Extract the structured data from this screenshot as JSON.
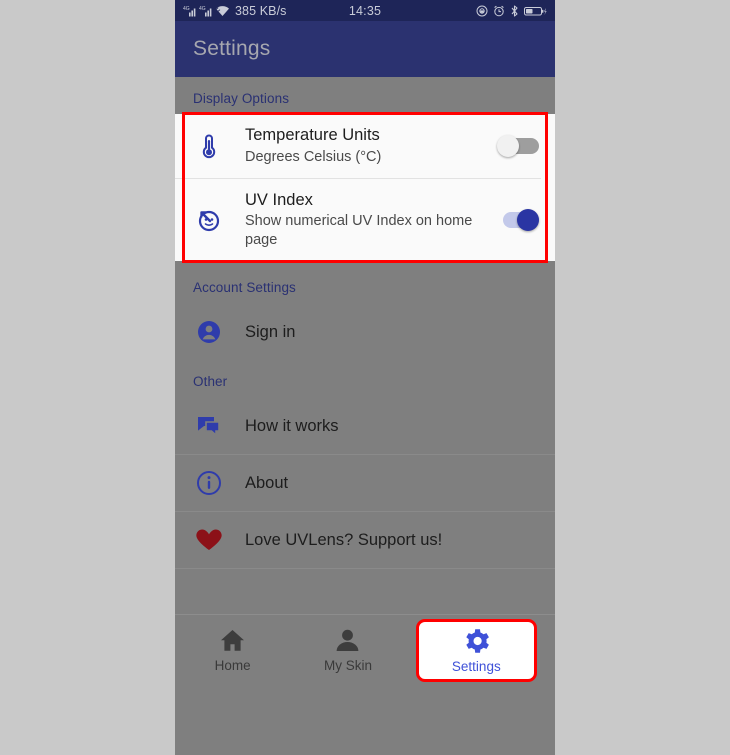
{
  "colors": {
    "outer_background": "#c9c9c9",
    "statusbar_background": "#1e2558",
    "appbar_background": "#2b3270",
    "app_background": "#7f7f7f",
    "card_background": "#fafafa",
    "section_header_text": "#2a3173",
    "accent_blue": "#2a35a3",
    "nav_active_blue": "#3f51d8",
    "heart_red": "#8c1118",
    "annotation_red": "#ff0000",
    "toggle_off_track": "#9e9e9e",
    "toggle_on_track": "#c3c9ea"
  },
  "status_bar": {
    "network_speed": "385 KB/s",
    "time": "14:35",
    "left_icons": [
      "signal-icon-sim1",
      "signal-icon-sim2",
      "wifi-icon"
    ],
    "right_icons": [
      "do-not-disturb-icon",
      "alarm-icon",
      "bluetooth-icon",
      "battery-charging-icon"
    ]
  },
  "app_bar": {
    "title": "Settings"
  },
  "sections": [
    {
      "header": "Display Options",
      "highlighted": true,
      "items": [
        {
          "icon": "thermometer-icon",
          "title": "Temperature Units",
          "subtitle": "Degrees Celsius (°C)",
          "control": "toggle",
          "toggle_state": "off"
        },
        {
          "icon": "uv-index-icon",
          "title": "UV Index",
          "subtitle": "Show numerical UV Index on home page",
          "control": "toggle",
          "toggle_state": "on"
        }
      ]
    },
    {
      "header": "Account Settings",
      "highlighted": false,
      "items": [
        {
          "icon": "account-circle-icon",
          "title": "Sign in",
          "subtitle": "",
          "control": "none"
        }
      ]
    },
    {
      "header": "Other",
      "highlighted": false,
      "items": [
        {
          "icon": "forum-icon",
          "title": "How it works",
          "subtitle": "",
          "control": "none"
        },
        {
          "icon": "info-icon",
          "title": "About",
          "subtitle": "",
          "control": "none"
        },
        {
          "icon": "heart-icon",
          "title": "Love UVLens? Support us!",
          "subtitle": "",
          "control": "none"
        }
      ]
    }
  ],
  "bottom_nav": {
    "items": [
      {
        "label": "Home",
        "icon": "home-icon",
        "active": false
      },
      {
        "label": "My Skin",
        "icon": "person-icon",
        "active": false
      },
      {
        "label": "Settings",
        "icon": "gear-icon",
        "active": true
      }
    ]
  }
}
